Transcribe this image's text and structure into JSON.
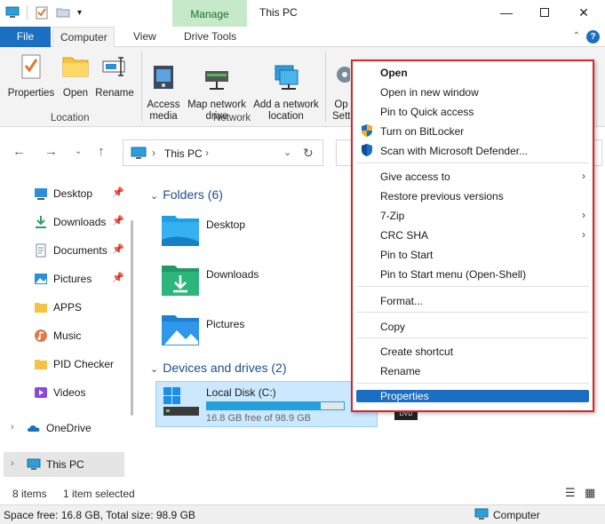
{
  "window": {
    "title": "This PC",
    "manage_tab": "Manage"
  },
  "ribbon_tabs": [
    "File",
    "Computer",
    "View",
    "Drive Tools"
  ],
  "ribbon": {
    "properties": "Properties",
    "open": "Open",
    "rename": "Rename",
    "location_group": "Location",
    "access_media": "Access\nmedia",
    "map_network_drive": "Map network\ndrive",
    "add_network_location": "Add a network\nlocation",
    "network_group": "Network",
    "open_settings_partial": "Op\nSett"
  },
  "address": {
    "path": "This PC"
  },
  "nav_pane": {
    "items": [
      {
        "label": "Desktop",
        "pinned": true
      },
      {
        "label": "Downloads",
        "pinned": true
      },
      {
        "label": "Documents",
        "pinned": true
      },
      {
        "label": "Pictures",
        "pinned": true
      },
      {
        "label": "APPS",
        "pinned": false
      },
      {
        "label": "Music",
        "pinned": false
      },
      {
        "label": "PID Checker",
        "pinned": false
      },
      {
        "label": "Videos",
        "pinned": false
      }
    ],
    "onedrive": "OneDrive",
    "this_pc": "This PC"
  },
  "content": {
    "folders_heading": "Folders (6)",
    "folders": [
      "Desktop",
      "Downloads",
      "Pictures"
    ],
    "devices_heading": "Devices and drives (2)",
    "drive": {
      "name": "Local Disk (C:)",
      "free": "16.8 GB free of 98.9 GB",
      "used_fraction": 0.83
    },
    "dvd_label": "DVD"
  },
  "status": {
    "items": "8 items",
    "selected": "1 item selected",
    "space": "Space free: 16.8 GB, Total size: 98.9 GB",
    "computer": "Computer"
  },
  "context_menu": {
    "items": [
      {
        "label": "Open"
      },
      {
        "label": "Open in new window"
      },
      {
        "label": "Pin to Quick access"
      },
      {
        "label": "Turn on BitLocker"
      },
      {
        "label": "Scan with Microsoft Defender..."
      },
      {
        "label": "Give access to"
      },
      {
        "label": "Restore previous versions"
      },
      {
        "label": "7-Zip"
      },
      {
        "label": "CRC SHA"
      },
      {
        "label": "Pin to Start"
      },
      {
        "label": "Pin to Start menu (Open-Shell)"
      },
      {
        "label": "Format..."
      },
      {
        "label": "Copy"
      },
      {
        "label": "Create shortcut"
      },
      {
        "label": "Rename"
      },
      {
        "label": "Properties"
      }
    ]
  },
  "colors": {
    "accent": "#1a6fc3",
    "manage_bg": "#c6e9c9",
    "highlight_border": "#d9262c",
    "drive_bar": "#26a0da"
  }
}
